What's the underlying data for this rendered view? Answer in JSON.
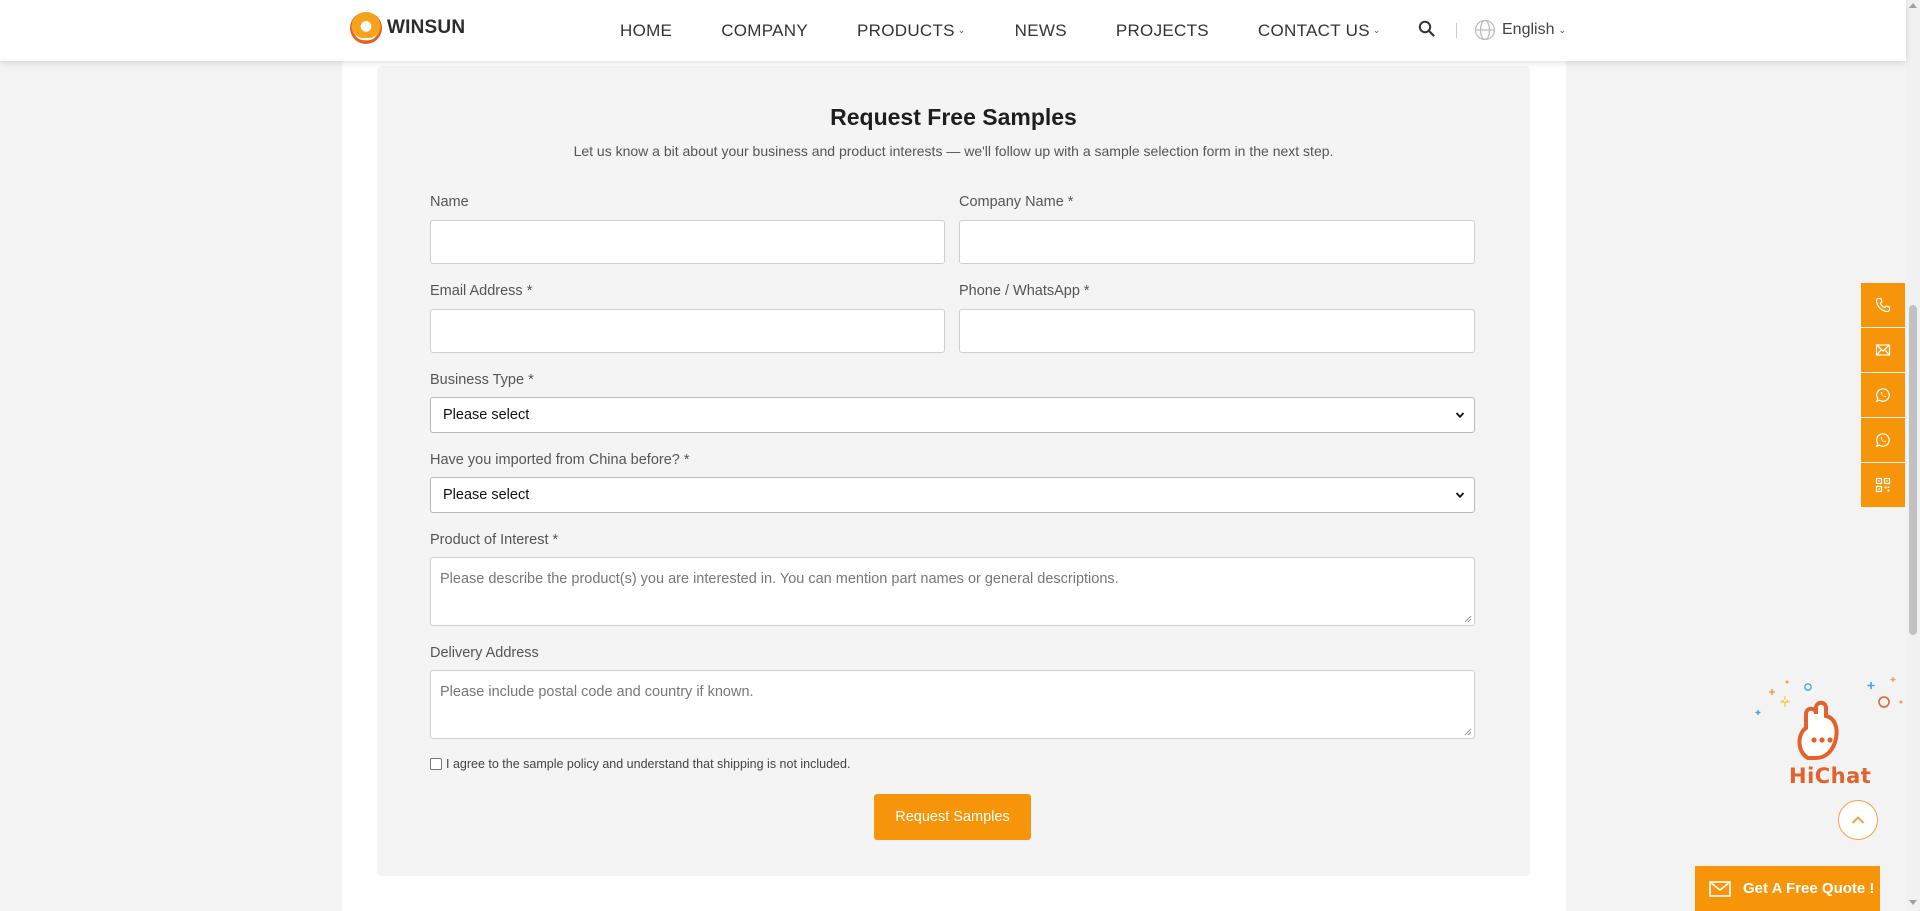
{
  "header": {
    "brand": "WINSUN",
    "nav": [
      {
        "label": "HOME",
        "has_caret": false
      },
      {
        "label": "COMPANY",
        "has_caret": false
      },
      {
        "label": "PRODUCTS",
        "has_caret": true
      },
      {
        "label": "NEWS",
        "has_caret": false
      },
      {
        "label": "PROJECTS",
        "has_caret": false
      },
      {
        "label": "CONTACT US",
        "has_caret": true
      }
    ],
    "search_icon": "search-icon",
    "language": "English"
  },
  "form": {
    "title": "Request Free Samples",
    "subtitle": "Let us know a bit about your business and product interests — we'll follow up with a sample selection form in the next step.",
    "fields": {
      "name": {
        "label": "Name",
        "value": ""
      },
      "company": {
        "label": "Company Name *",
        "value": ""
      },
      "email": {
        "label": "Email Address *",
        "value": ""
      },
      "phone": {
        "label": "Phone / WhatsApp *",
        "value": ""
      },
      "business_type": {
        "label": "Business Type *",
        "selected": "Please select"
      },
      "imported": {
        "label": "Have you imported from China before? *",
        "selected": "Please select"
      },
      "product": {
        "label": "Product of Interest *",
        "placeholder": "Please describe the product(s) you are interested in. You can mention part names or general descriptions."
      },
      "delivery": {
        "label": "Delivery Address",
        "placeholder": "Please include postal code and country if known."
      }
    },
    "consent": {
      "text": "I agree to the sample policy and understand that shipping is not included.",
      "checked": false
    },
    "submit_label": "Request Samples"
  },
  "contact_rail": [
    {
      "icon": "phone-icon"
    },
    {
      "icon": "email-icon"
    },
    {
      "icon": "whatsapp-icon"
    },
    {
      "icon": "whatsapp-icon"
    },
    {
      "icon": "qr-code-icon"
    }
  ],
  "hichat": {
    "label": "HiChat"
  },
  "quote_button": {
    "label": "Get A Free Quote !"
  },
  "colors": {
    "accent": "#f7950a",
    "brand_orange": "#e1622b"
  }
}
